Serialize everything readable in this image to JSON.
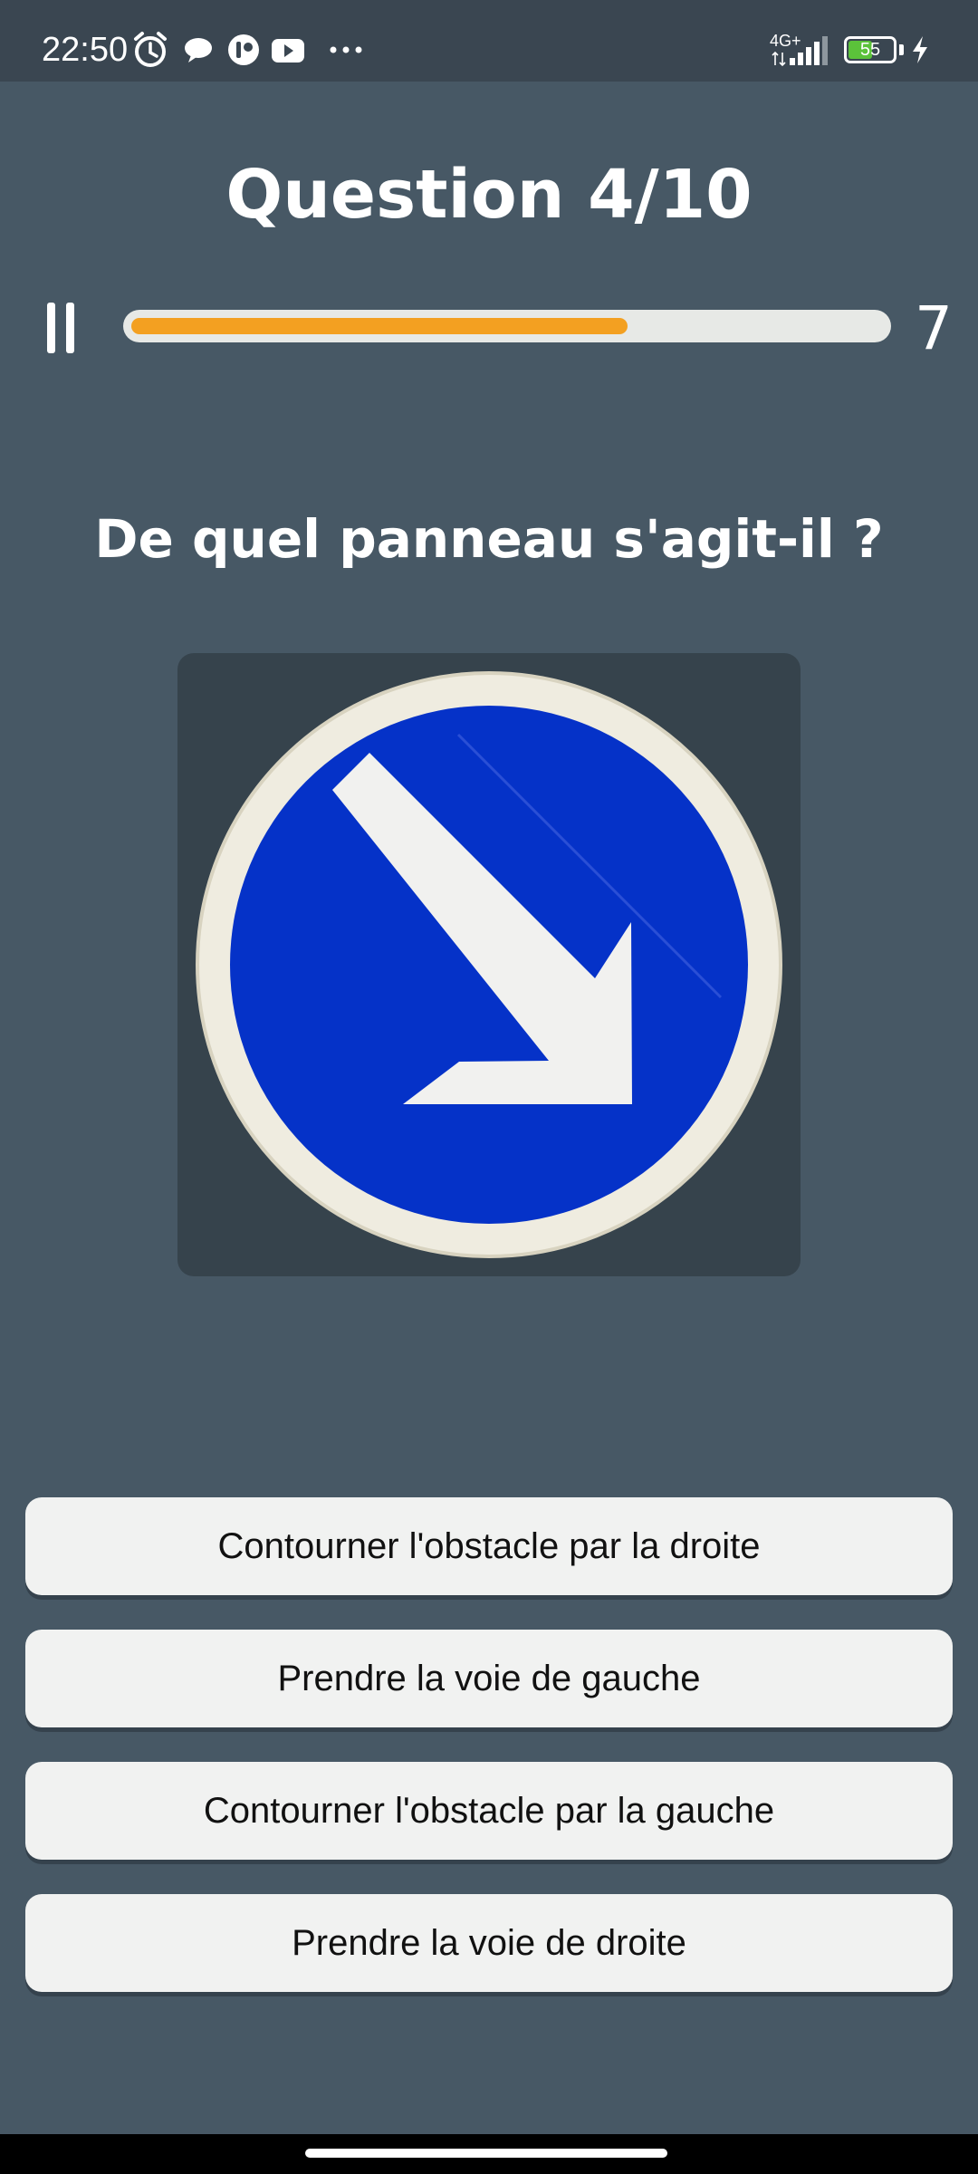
{
  "status_bar": {
    "time": "22:50",
    "icons": [
      "alarm-icon",
      "chat-bubble-icon",
      "app-notification-icon",
      "youtube-icon",
      "more-dots-icon"
    ],
    "network": "4G+",
    "battery_level": "55",
    "battery_fraction": 0.55,
    "charging": true
  },
  "quiz": {
    "title": "Question 4/10",
    "progress_fraction": 0.66,
    "timer": "7",
    "prompt": "De quel panneau s'agit-il ?",
    "image": "keep-right-road-sign"
  },
  "answers": [
    {
      "label": "Contourner l'obstacle par la droite"
    },
    {
      "label": "Prendre la voie de gauche"
    },
    {
      "label": "Contourner l'obstacle par la gauche"
    },
    {
      "label": "Prendre la voie de droite"
    }
  ],
  "colors": {
    "background": "#475865",
    "progress_fill": "#f3a021",
    "progress_track": "#e7e9e6",
    "sign_blue": "#0532c8",
    "button_bg": "#f1f2f1",
    "battery_fill": "#5bc23a"
  }
}
